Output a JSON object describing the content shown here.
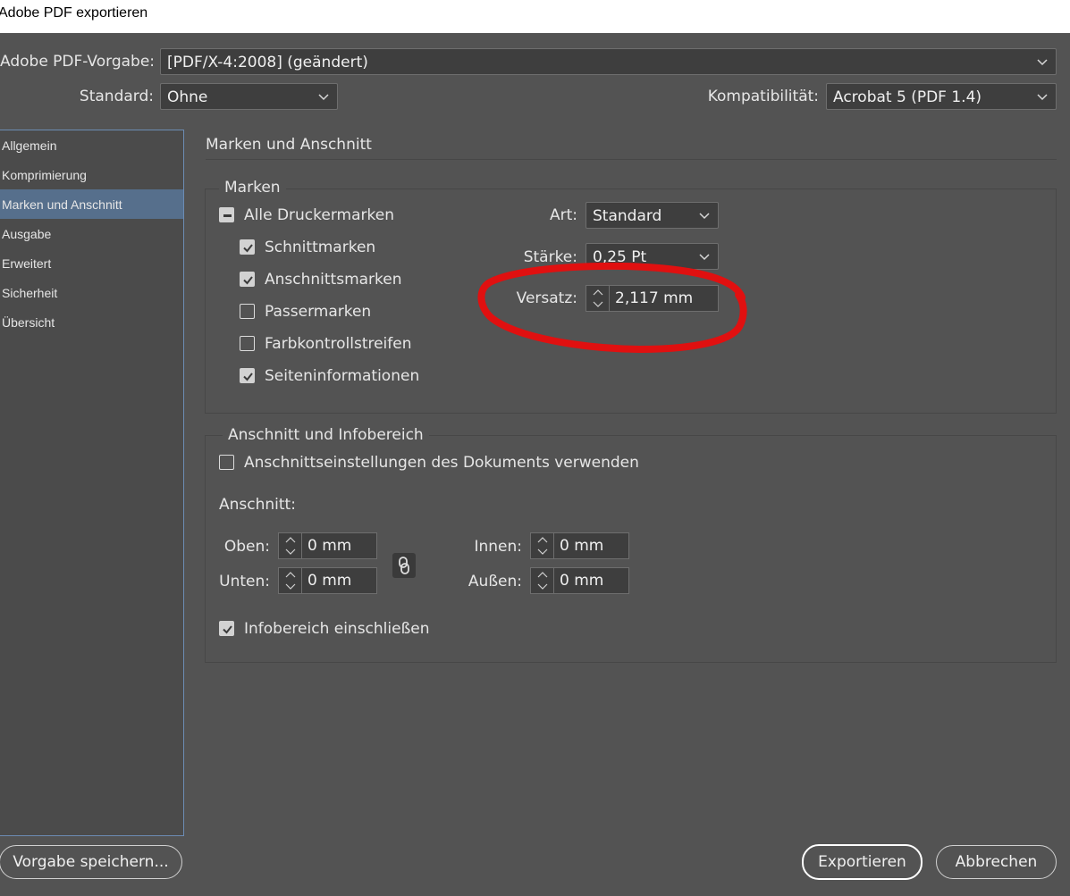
{
  "window": {
    "title": "Adobe PDF exportieren"
  },
  "preset": {
    "label": "Adobe PDF-Vorgabe:",
    "value": "[PDF/X-4:2008] (geändert)"
  },
  "standard": {
    "label": "Standard:",
    "value": "Ohne"
  },
  "compat": {
    "label": "Kompatibilität:",
    "value": "Acrobat 5 (PDF 1.4)"
  },
  "sidebar": {
    "items": [
      {
        "label": "Allgemein"
      },
      {
        "label": "Komprimierung"
      },
      {
        "label": "Marken und Anschnitt"
      },
      {
        "label": "Ausgabe"
      },
      {
        "label": "Erweitert"
      },
      {
        "label": "Sicherheit"
      },
      {
        "label": "Übersicht"
      }
    ],
    "selected": "Marken und Anschnitt"
  },
  "panel": {
    "title": "Marken und Anschnitt"
  },
  "marks": {
    "legend": "Marken",
    "all_label": "Alle Druckermarken",
    "items": [
      {
        "label": "Schnittmarken",
        "checked": true
      },
      {
        "label": "Anschnittsmarken",
        "checked": true
      },
      {
        "label": "Passermarken",
        "checked": false
      },
      {
        "label": "Farbkontrollstreifen",
        "checked": false
      },
      {
        "label": "Seiteninformationen",
        "checked": true
      }
    ],
    "art": {
      "label": "Art:",
      "value": "Standard"
    },
    "staerke": {
      "label": "Stärke:",
      "value": "0,25 Pt"
    },
    "versatz": {
      "label": "Versatz:",
      "value": "2,117 mm"
    }
  },
  "bleed": {
    "legend": "Anschnitt und Infobereich",
    "doc_settings_label": "Anschnittseinstellungen des Dokuments verwenden",
    "doc_settings_checked": false,
    "anschnitt_label": "Anschnitt:",
    "oben": {
      "label": "Oben:",
      "value": "0 mm"
    },
    "unten": {
      "label": "Unten:",
      "value": "0 mm"
    },
    "innen": {
      "label": "Innen:",
      "value": "0 mm"
    },
    "aussen": {
      "label": "Außen:",
      "value": "0 mm"
    },
    "slug_label": "Infobereich einschließen",
    "slug_checked": true
  },
  "buttons": {
    "save_preset": "Vorgabe speichern...",
    "export": "Exportieren",
    "cancel": "Abbrechen"
  },
  "colors": {
    "dialog_bg": "#535353",
    "selection": "#566f8c",
    "annotation": "#e01010"
  },
  "annotation": {
    "shape": "freehand-circle",
    "around": "Versatz"
  }
}
